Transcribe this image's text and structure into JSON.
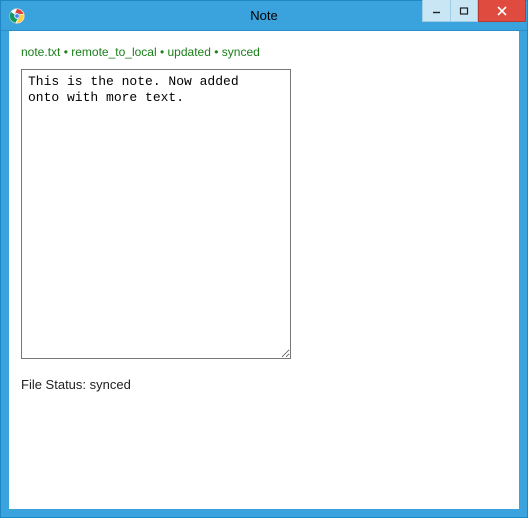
{
  "window": {
    "title": "Note"
  },
  "status_line": {
    "filename": "note.txt",
    "direction": "remote_to_local",
    "action": "updated",
    "sync_state": "synced",
    "separator": " • "
  },
  "editor": {
    "content": "This is the note. Now added\nonto with more text."
  },
  "file_status": {
    "label": "File Status:",
    "value": "synced"
  },
  "icons": {
    "app": "chrome-icon",
    "minimize": "minimize-icon",
    "maximize": "maximize-icon",
    "close": "close-icon"
  }
}
